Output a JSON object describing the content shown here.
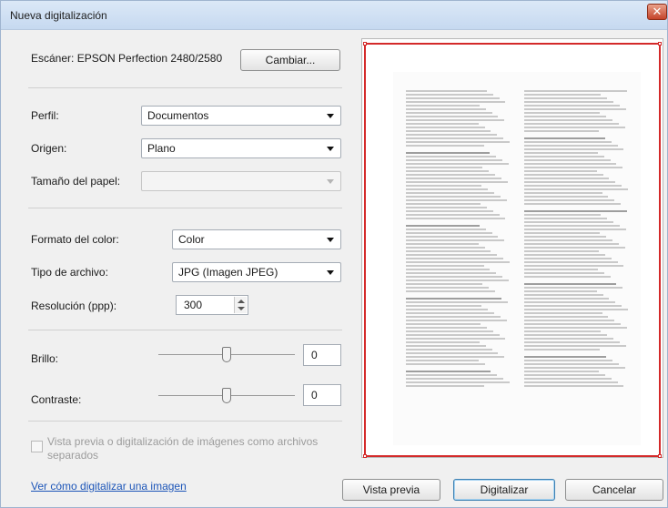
{
  "window": {
    "title": "Nueva digitalización",
    "close_glyph": "✕"
  },
  "scanner": {
    "label": "Escáner: EPSON Perfection 2480/2580",
    "change_button": "Cambiar..."
  },
  "profile": {
    "label": "Perfil:",
    "value": "Documentos"
  },
  "source": {
    "label": "Origen:",
    "value": "Plano"
  },
  "paper_size": {
    "label": "Tamaño del papel:",
    "value": ""
  },
  "color_format": {
    "label": "Formato del color:",
    "value": "Color"
  },
  "file_type": {
    "label": "Tipo de archivo:",
    "value": "JPG (Imagen JPEG)"
  },
  "resolution": {
    "label": "Resolución (ppp):",
    "value": "300"
  },
  "brightness": {
    "label": "Brillo:",
    "value": "0",
    "level": 0.5
  },
  "contrast": {
    "label": "Contraste:",
    "value": "0",
    "level": 0.5
  },
  "separate_files": {
    "label_line1": "Vista previa o digitalización de imágenes como archivos",
    "label_line2": "separados",
    "checked": false
  },
  "help_link": "Ver cómo digitalizar una imagen",
  "buttons": {
    "preview": "Vista previa",
    "scan": "Digitalizar",
    "cancel": "Cancelar"
  },
  "colors": {
    "selection_frame": "#d42a2a",
    "link": "#1c55b8"
  }
}
